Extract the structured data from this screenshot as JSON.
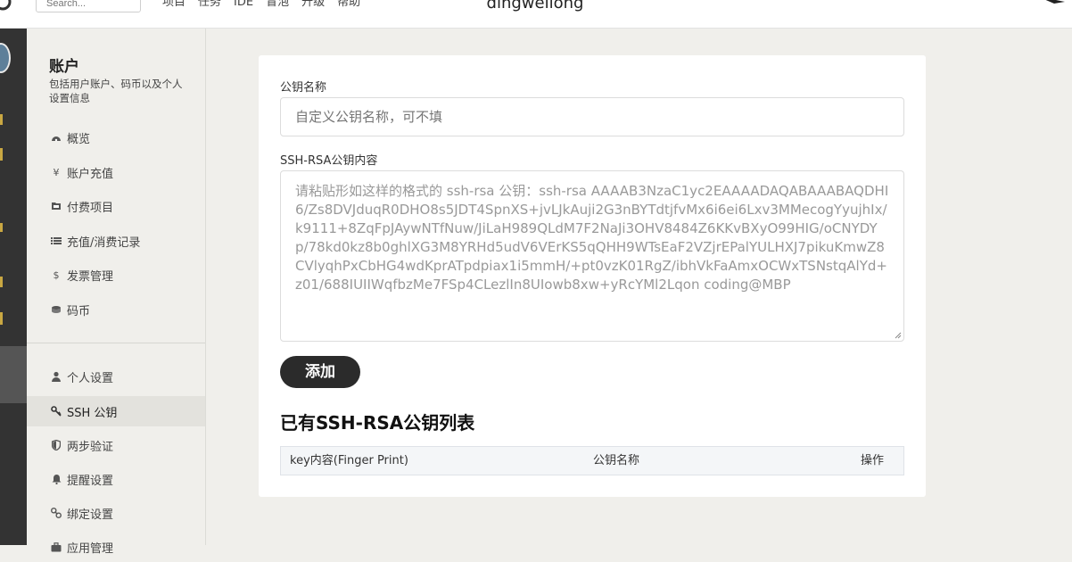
{
  "topbar": {
    "search_placeholder": "Search...",
    "nav": [
      "项目",
      "任务",
      "IDE",
      "冒泡",
      "升级",
      "帮助"
    ],
    "username": "dingweilong"
  },
  "sidebar": {
    "title": "账户",
    "description": "包括用户账户、码币以及个人设置信息",
    "items": [
      {
        "label": "概览",
        "icon": "dashboard-icon"
      },
      {
        "label": "账户充值",
        "icon": "yen-icon"
      },
      {
        "label": "付费项目",
        "icon": "folder-icon"
      },
      {
        "label": "充值/消费记录",
        "icon": "list-icon"
      },
      {
        "label": "发票管理",
        "icon": "dollar-icon"
      },
      {
        "label": "码币",
        "icon": "coins-icon"
      },
      {
        "label": "个人设置",
        "icon": "user-icon"
      },
      {
        "label": "SSH 公钥",
        "icon": "key-icon"
      },
      {
        "label": "两步验证",
        "icon": "shield-icon"
      },
      {
        "label": "提醒设置",
        "icon": "bell-icon"
      },
      {
        "label": "绑定设置",
        "icon": "link-icon"
      },
      {
        "label": "应用管理",
        "icon": "briefcase-icon"
      }
    ],
    "active_item": "SSH 公钥"
  },
  "form": {
    "name_label": "公钥名称",
    "name_placeholder": "自定义公钥名称，可不填",
    "content_label": "SSH-RSA公钥内容",
    "content_placeholder": "请粘贴形如这样的格式的 ssh-rsa 公钥：ssh-rsa AAAAB3NzaC1yc2EAAAADAQABAAABAQDHI6/Zs8DVJduqR0DHO8s5JDT4SpnXS+jvLJkAuji2G3nBYTdtjfvMx6i6ei6Lxv3MMecogYyujhIx/k9111+8ZqFpJAywNTfNuw/JiLaH989QLdM7F2NaJi3OHV8484Z6KKvBXyO99HIG/oCNYDYp/78kd0kz8b0ghlXG3M8YRHd5udV6VErKS5qQHH9WTsEaF2VZjrEPalYULHXJ7pikuKmwZ8CVlyqhPxCbHG4wdKprATpdpiax1i5mmH/+pt0vzK01RgZ/ibhVkFaAmxOCWxTSNstqAlYd+z01/688IUIIWqfbzMe7FSp4CLezlIn8UIowb8xw+yRcYMl2Lqon coding@MBP",
    "add_button": "添加"
  },
  "key_list": {
    "title": "已有SSH-RSA公钥列表",
    "columns": [
      "key内容(Finger Print)",
      "公钥名称",
      "操作"
    ],
    "rows": []
  },
  "colors": {
    "page_bg": "#f0efeb",
    "rail_bg": "#333333",
    "button_bg": "#2b2b2b",
    "table_head_bg": "#f4f6f8"
  }
}
